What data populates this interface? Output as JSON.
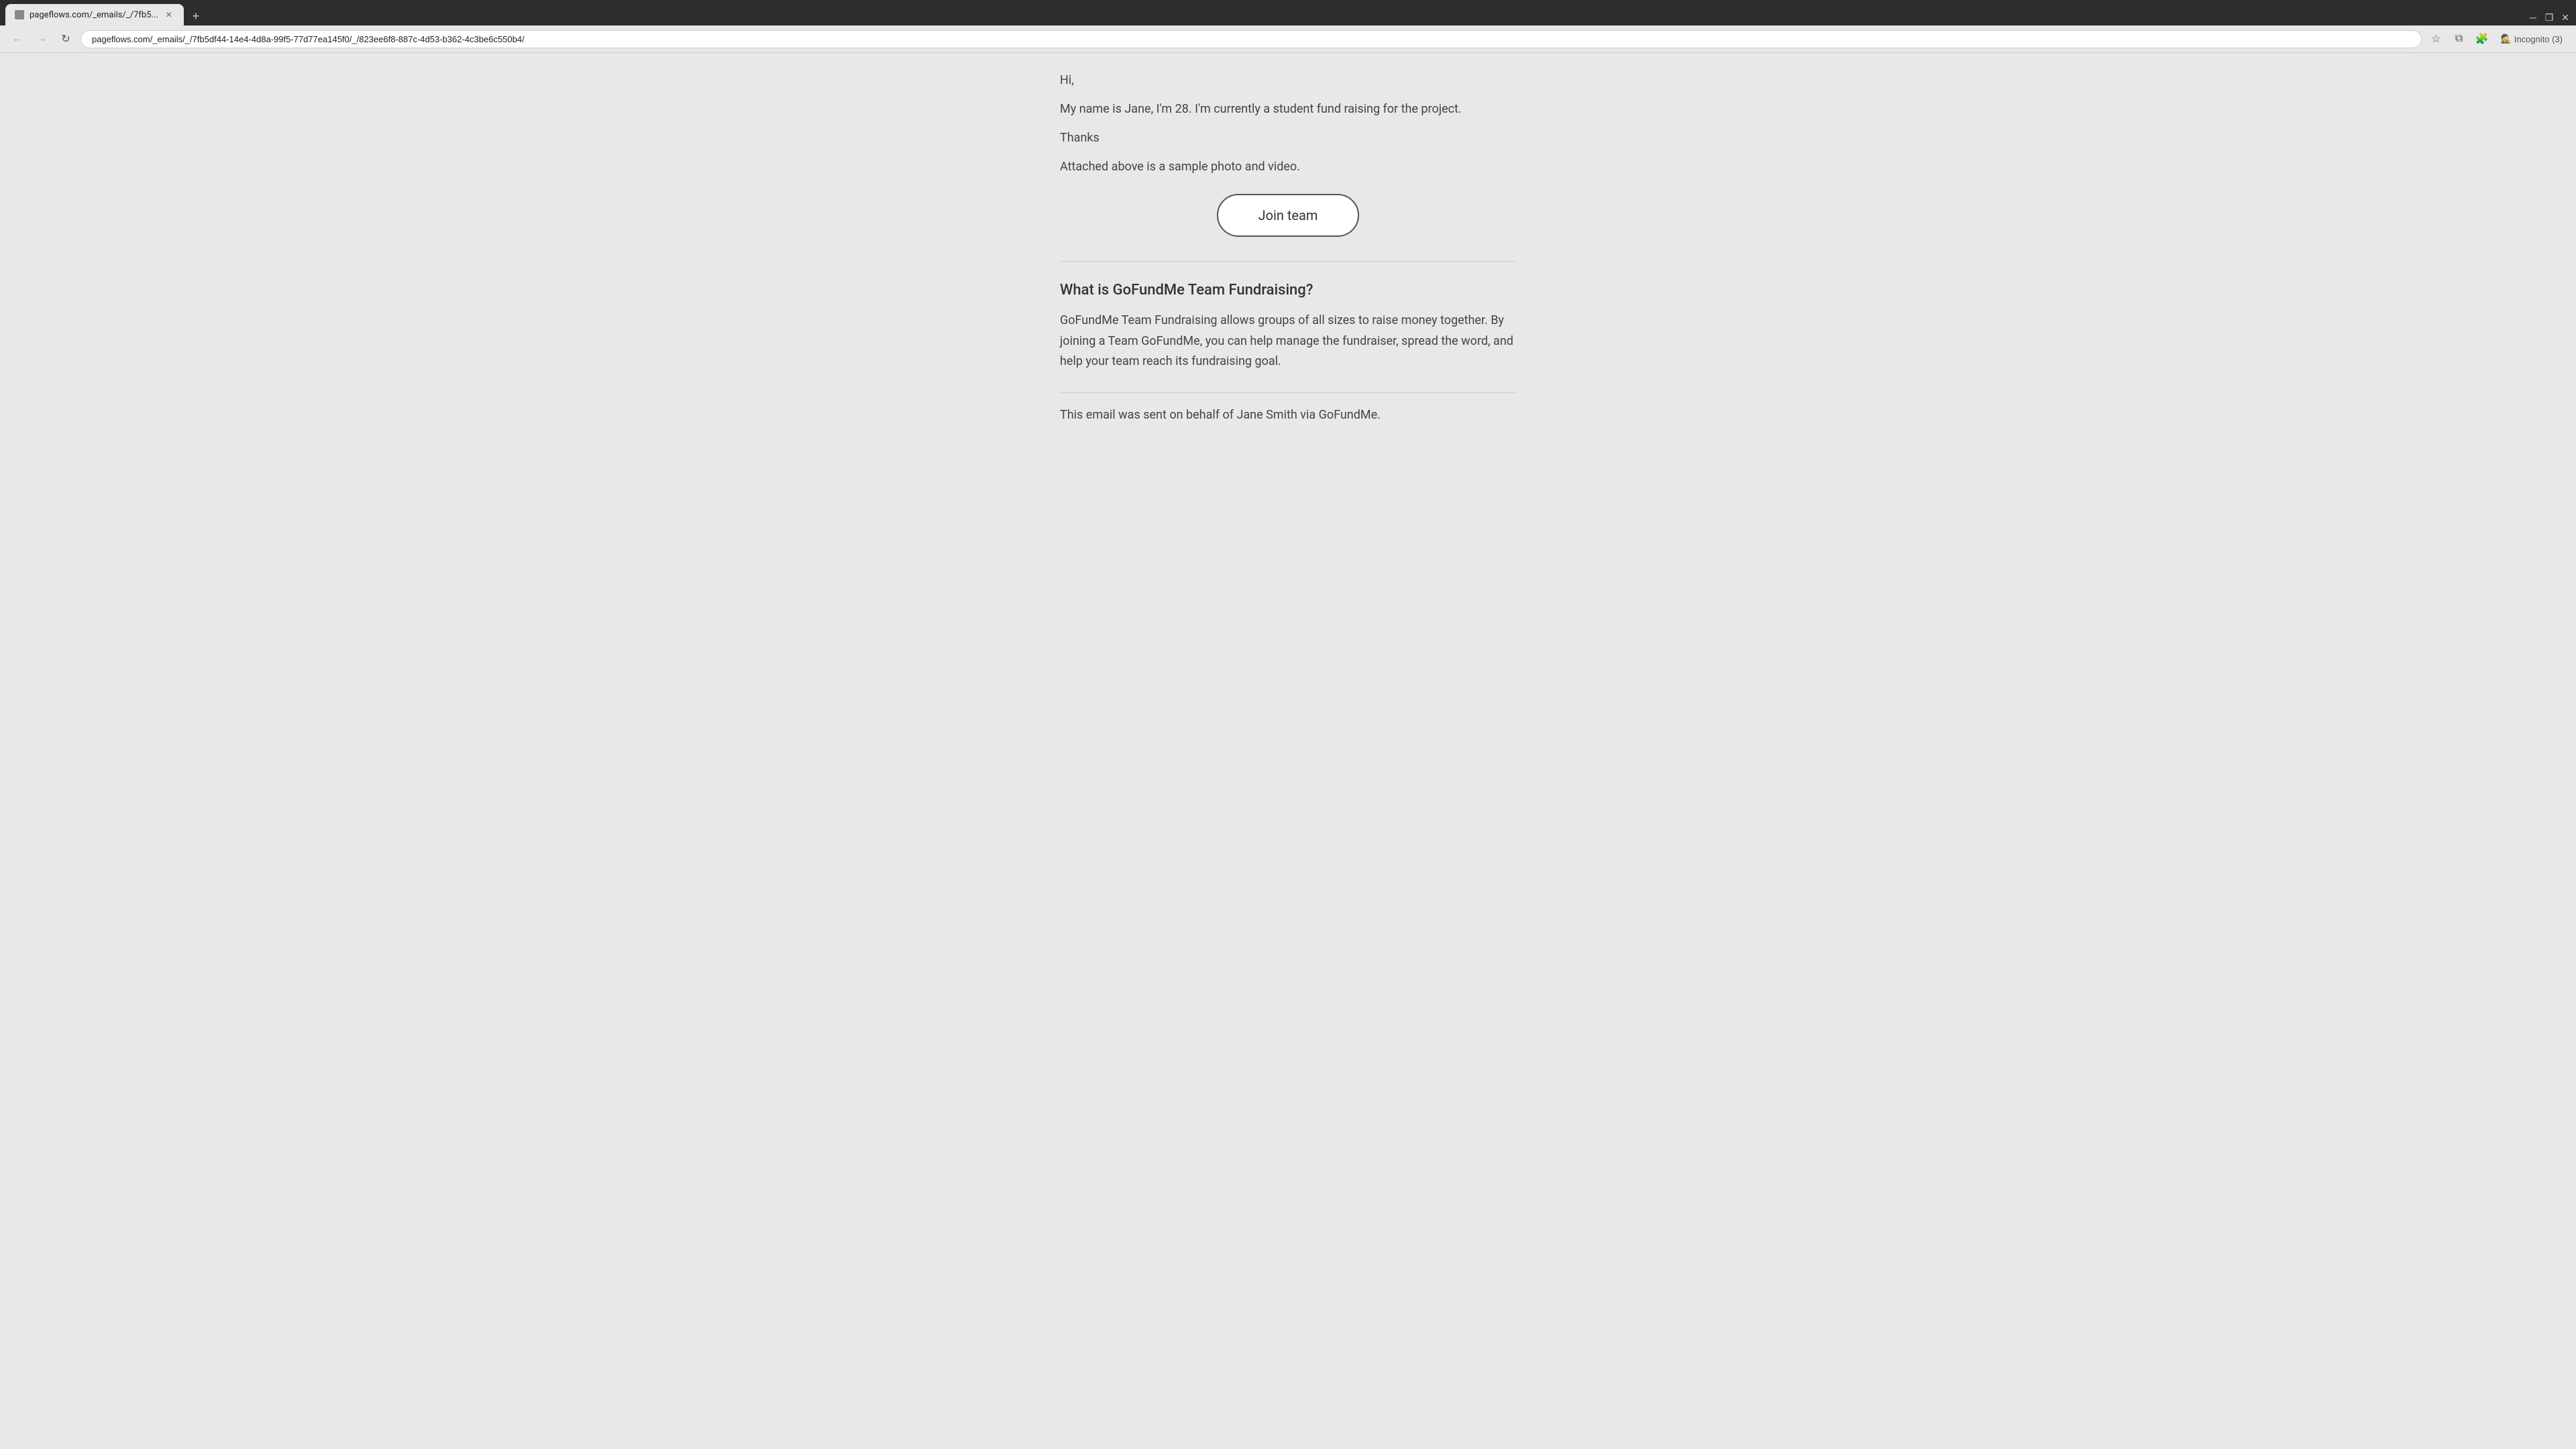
{
  "browser": {
    "tab": {
      "title": "pageflows.com/_emails/_/7fb5...",
      "favicon": "globe"
    },
    "new_tab_label": "+",
    "address": "pageflows.com/_emails/_/7fb5df44-14e4-4d8a-99f5-77d77ea145f0/_/823ee6f8-887c-4d53-b362-4c3be6c550b4/",
    "incognito_label": "Incognito (3)"
  },
  "email": {
    "greeting": "Hi,",
    "paragraph1": "My name is Jane, I'm 28. I'm currently a student fund raising for the project.",
    "thanks": "Thanks",
    "paragraph2": "Attached above is a sample photo and video.",
    "join_button_label": "Join team",
    "section_heading": "What is GoFundMe Team Fundraising?",
    "section_text": "GoFundMe Team Fundraising allows groups of all sizes to raise money together. By joining a Team GoFundMe, you can help manage the fundraiser, spread the word, and help your team reach its fundraising goal.",
    "footer_text": "This email was sent on behalf of Jane Smith via GoFundMe."
  },
  "nav": {
    "back_title": "Back",
    "forward_title": "Forward",
    "refresh_title": "Refresh",
    "bookmark_title": "Bookmark",
    "profile_title": "Profile",
    "extensions_title": "Extensions"
  }
}
